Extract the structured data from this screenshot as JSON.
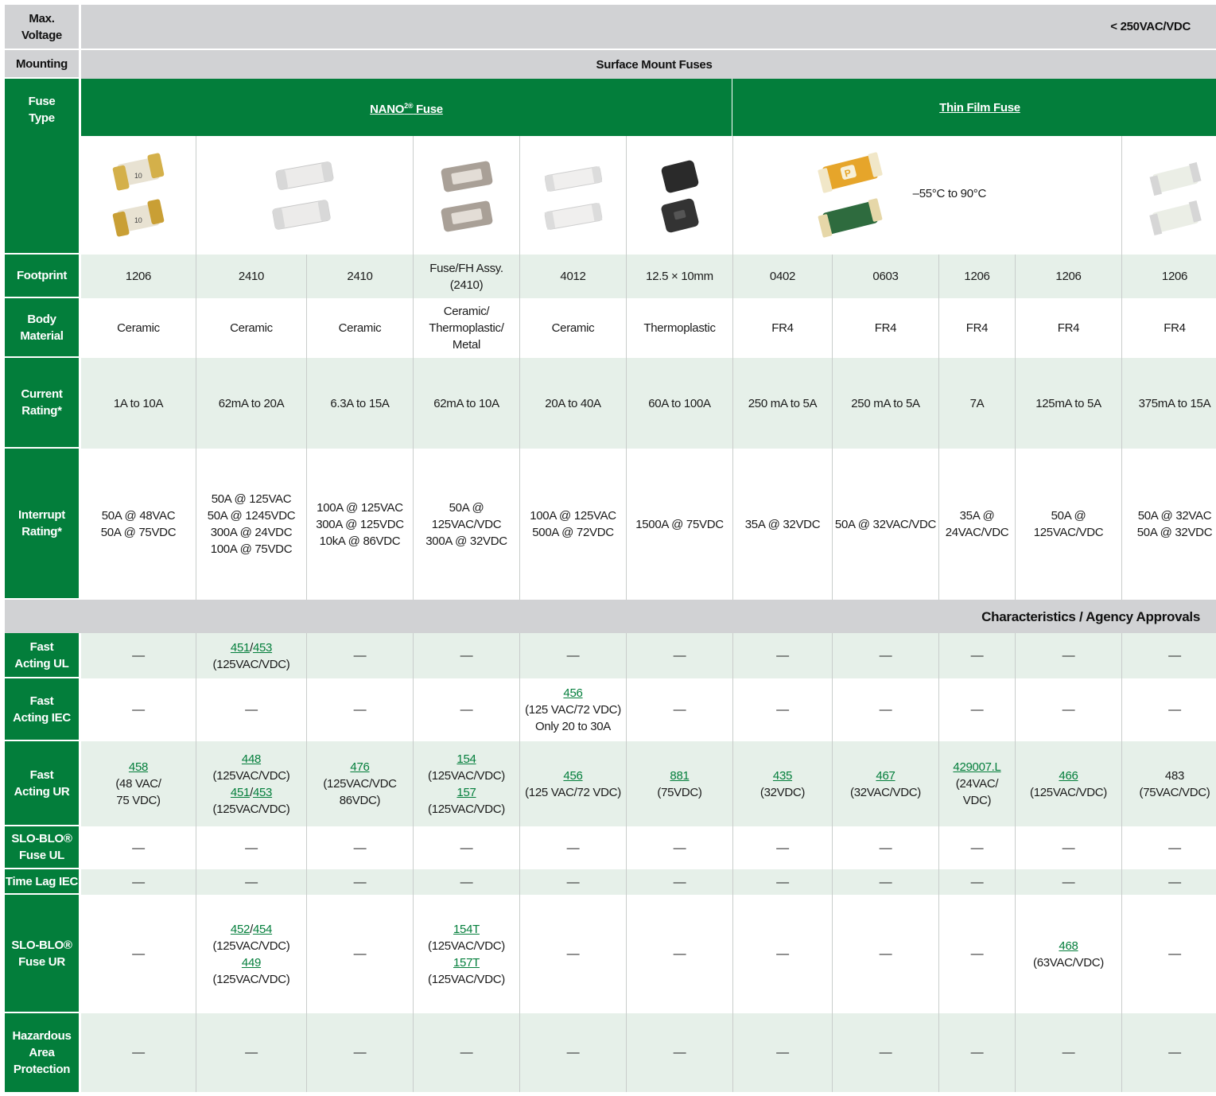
{
  "header": {
    "max_voltage_label": "Max.\nVoltage",
    "max_voltage_value": "< 250VAC/VDC",
    "mounting_label": "Mounting",
    "mounting_value": "Surface Mount Fuses"
  },
  "fuse_type": {
    "label": "Fuse\nType",
    "family_nano_main": "NANO",
    "family_nano_sup": "2®",
    "family_nano_suffix": " Fuse",
    "family_thin_film": "Thin Film Fuse",
    "temperature_note": "–55°C to 90°C"
  },
  "footprint": {
    "label": "Footprint",
    "values": [
      "1206",
      "2410",
      "2410",
      "Fuse/FH Assy.\n(2410)",
      "4012",
      "12.5 × 10mm",
      "0402",
      "0603",
      "1206",
      "1206",
      "1206"
    ]
  },
  "body_material": {
    "label": "Body\nMaterial",
    "values": [
      "Ceramic",
      "Ceramic",
      "Ceramic",
      "Ceramic/\nThermoplastic/\nMetal",
      "Ceramic",
      "Thermoplastic",
      "FR4",
      "FR4",
      "FR4",
      "FR4",
      "FR4"
    ]
  },
  "current_rating": {
    "label": "Current\nRating*",
    "values": [
      "1A to 10A",
      "62mA to 20A",
      "6.3A to 15A",
      "62mA to 10A",
      "20A to 40A",
      "60A to 100A",
      "250 mA to 5A",
      "250 mA to 5A",
      "7A",
      "125mA to 5A",
      "375mA to 15A"
    ]
  },
  "interrupt_rating": {
    "label": "Interrupt\nRating*",
    "values": [
      "50A @ 48VAC\n50A @ 75VDC",
      "50A @ 125VAC\n50A @ 1245VDC\n300A @ 24VDC\n100A @ 75VDC",
      "100A @ 125VAC\n300A @ 125VDC\n10kA @ 86VDC",
      "50A @ 125VAC/VDC\n300A @ 32VDC",
      "100A @ 125VAC\n500A @ 72VDC",
      "1500A @ 75VDC",
      "35A @ 32VDC",
      "50A @ 32VAC/VDC",
      "35A @\n24VAC/VDC",
      "50A @\n125VAC/VDC",
      "50A @ 32VAC\n50A @ 32VDC"
    ]
  },
  "section_title": "Characteristics / Agency Approvals",
  "dash": "—",
  "fast_acting_ul": {
    "label": "Fast\nActing UL",
    "col2": {
      "link_a": "451",
      "sep": "/",
      "link_b": "453",
      "text": "(125VAC/VDC)"
    }
  },
  "fast_acting_iec": {
    "label": "Fast\nActing IEC",
    "col5": {
      "link": "456",
      "text": "(125 VAC/72 VDC)\nOnly 20 to 30A"
    }
  },
  "fast_acting_ur": {
    "label": "Fast\nActing UR",
    "cells": [
      {
        "link": "458",
        "text": "(48 VAC/\n75 VDC)"
      },
      {
        "link": "448",
        "text": "(125VAC/VDC)",
        "link2a": "451",
        "link2b": "453",
        "text2": "(125VAC/VDC)"
      },
      {
        "link": "476",
        "text": "(125VAC/VDC\n86VDC)"
      },
      {
        "link": "154",
        "text": "(125VAC/VDC)",
        "link2": "157",
        "text2": "(125VAC/VDC)"
      },
      {
        "link": "456",
        "text": "(125 VAC/72 VDC)"
      },
      {
        "link": "881",
        "text": "(75VDC)"
      },
      {
        "link": "435",
        "text": "(32VDC)"
      },
      {
        "link": "467",
        "text": "(32VAC/VDC)"
      },
      {
        "link": "429007.L",
        "text": "(24VAC/\nVDC)"
      },
      {
        "link": "466",
        "text": "(125VAC/VDC)"
      },
      {
        "plain": "483",
        "text": "(75VAC/VDC)"
      }
    ]
  },
  "slo_blo_ul": {
    "label": "SLO-BLO®\nFuse UL"
  },
  "time_lag_iec": {
    "label": "Time Lag IEC"
  },
  "slo_blo_ur": {
    "label": "SLO-BLO®\nFuse UR",
    "col2": {
      "link_a": "452",
      "sep": "/",
      "link_b": "454",
      "text": "(125VAC/VDC)",
      "link2": "449",
      "text2": "(125VAC/VDC)"
    },
    "col4": {
      "link": "154T",
      "text": "(125VAC/VDC)",
      "link2": "157T",
      "text2": "(125VAC/VDC)"
    },
    "col10": {
      "link": "468",
      "text": "(63VAC/VDC)"
    }
  },
  "hazardous": {
    "label": "Hazardous\nArea\nProtection"
  },
  "images": [
    "nano-1206-fuse-icon",
    "nano-2410-fuse-icon",
    "nano-fuseholder-icon",
    "nano-4012-fuse-icon",
    "nano-12x10-fuse-icon",
    "thin-film-0402-0603-fuse-icon",
    "thin-film-1206-fuse-icon"
  ],
  "colors": {
    "brand_green": "#037e3b",
    "tint_green": "#e6f0e9",
    "header_gray": "#d1d2d4"
  }
}
